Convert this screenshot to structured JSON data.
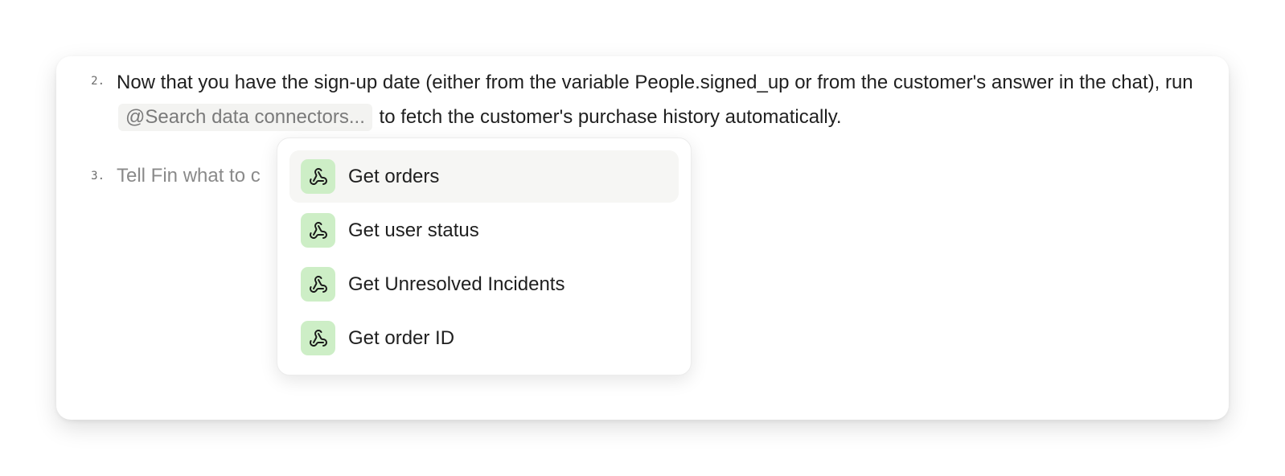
{
  "steps": [
    {
      "number": "2.",
      "text_before": "Now that you have the sign-up date (either from the variable People.signed_up or from the customer's answer in the chat), run",
      "chip": "@Search data connectors...",
      "text_after": "to fetch the customer's purchase history automatically."
    },
    {
      "number": "3.",
      "placeholder": "Tell Fin what to c"
    }
  ],
  "dropdown": {
    "options": [
      {
        "label": "Get orders",
        "icon": "webhook-icon",
        "active": true
      },
      {
        "label": "Get user status",
        "icon": "webhook-icon",
        "active": false
      },
      {
        "label": "Get Unresolved Incidents",
        "icon": "webhook-icon",
        "active": false
      },
      {
        "label": "Get order ID",
        "icon": "webhook-icon",
        "active": false
      }
    ]
  },
  "colors": {
    "icon_bg": "#cdeec6",
    "active_row_bg": "#f6f6f4",
    "chip_bg": "#f3f3f1"
  }
}
